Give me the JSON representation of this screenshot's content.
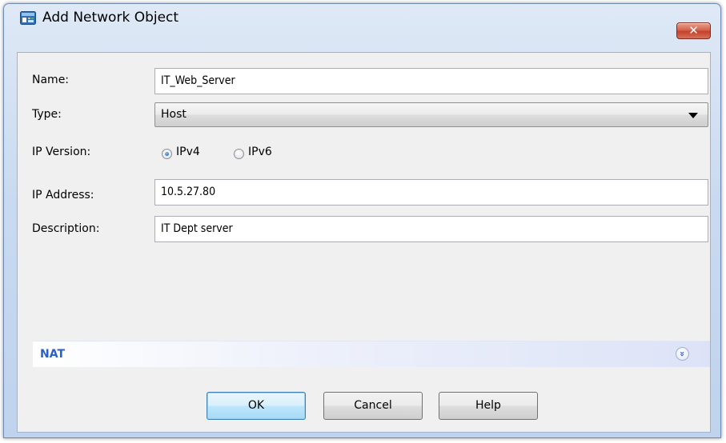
{
  "window": {
    "title": "Add Network Object",
    "close_glyph": "✕"
  },
  "form": {
    "name": {
      "label": "Name:",
      "value": "IT_Web_Server"
    },
    "type": {
      "label": "Type:",
      "value": "Host"
    },
    "ip_version": {
      "label": "IP Version:",
      "options": [
        "IPv4",
        "IPv6"
      ],
      "selected": "IPv4"
    },
    "ip_address": {
      "label": "IP Address:",
      "value": "10.5.27.80"
    },
    "description": {
      "label": "Description:",
      "value": "IT Dept server"
    }
  },
  "nat": {
    "label": "NAT",
    "expand_glyph": "»"
  },
  "buttons": {
    "ok": "OK",
    "cancel": "Cancel",
    "help": "Help"
  },
  "icons": {
    "app": "network-object-icon",
    "close": "close-icon",
    "expand": "double-chevron-down-icon",
    "dropdown": "chevron-down-icon"
  },
  "colors": {
    "accent": "#2b5fc9",
    "close_button": "#c5412a",
    "default_button_border": "#3c7fb1"
  }
}
